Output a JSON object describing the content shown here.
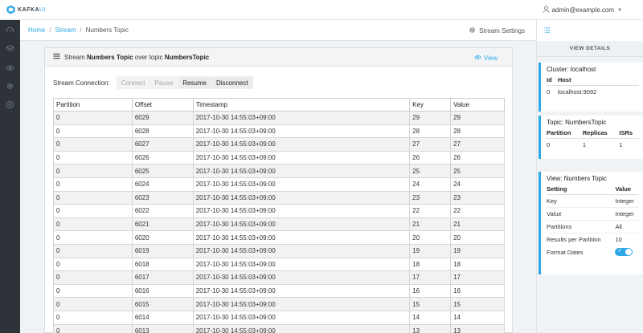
{
  "app": {
    "logo_main": "KAFKA",
    "logo_ui": "UI",
    "user_email": "admin@example.com"
  },
  "breadcrumb": {
    "home": "Home",
    "stream": "Stream",
    "current": "Numbers Topic"
  },
  "toolbar": {
    "stream_settings": "Stream Settings"
  },
  "card": {
    "prefix": "Stream",
    "stream_name": "Numbers Topic",
    "middle": "over topic",
    "topic_name": "NumbersTopic",
    "view_label": "View"
  },
  "connection": {
    "label": "Stream Connection:",
    "buttons": [
      {
        "label": "Connect",
        "enabled": false
      },
      {
        "label": "Pause",
        "enabled": false
      },
      {
        "label": "Resume",
        "enabled": true
      },
      {
        "label": "Disconnect",
        "enabled": true
      }
    ]
  },
  "messages": {
    "columns": [
      "Partition",
      "Offset",
      "Timestamp",
      "Key",
      "Value"
    ],
    "rows": [
      [
        "0",
        "6029",
        "2017-10-30 14:55:03+09:00",
        "29",
        "29"
      ],
      [
        "0",
        "6028",
        "2017-10-30 14:55:03+09:00",
        "28",
        "28"
      ],
      [
        "0",
        "6027",
        "2017-10-30 14:55:03+09:00",
        "27",
        "27"
      ],
      [
        "0",
        "6026",
        "2017-10-30 14:55:03+09:00",
        "26",
        "26"
      ],
      [
        "0",
        "6025",
        "2017-10-30 14:55:03+09:00",
        "25",
        "25"
      ],
      [
        "0",
        "6024",
        "2017-10-30 14:55:03+09:00",
        "24",
        "24"
      ],
      [
        "0",
        "6023",
        "2017-10-30 14:55:03+09:00",
        "23",
        "23"
      ],
      [
        "0",
        "6022",
        "2017-10-30 14:55:03+09:00",
        "22",
        "22"
      ],
      [
        "0",
        "6021",
        "2017-10-30 14:55:03+09:00",
        "21",
        "21"
      ],
      [
        "0",
        "6020",
        "2017-10-30 14:55:03+09:00",
        "20",
        "20"
      ],
      [
        "0",
        "6019",
        "2017-10-30 14:55:03+09:00",
        "19",
        "19"
      ],
      [
        "0",
        "6018",
        "2017-10-30 14:55:03+09:00",
        "18",
        "18"
      ],
      [
        "0",
        "6017",
        "2017-10-30 14:55:03+09:00",
        "17",
        "17"
      ],
      [
        "0",
        "6016",
        "2017-10-30 14:55:03+09:00",
        "16",
        "16"
      ],
      [
        "0",
        "6015",
        "2017-10-30 14:55:03+09:00",
        "15",
        "15"
      ],
      [
        "0",
        "6014",
        "2017-10-30 14:55:03+09:00",
        "14",
        "14"
      ],
      [
        "0",
        "6013",
        "2017-10-30 14:55:03+09:00",
        "13",
        "13"
      ]
    ]
  },
  "details": {
    "header": "VIEW DETAILS",
    "cluster": {
      "title": "Cluster: localhost",
      "columns": [
        "Id",
        "Host"
      ],
      "rows": [
        [
          "0",
          "localhost:9092"
        ]
      ]
    },
    "topic": {
      "title": "Topic: NumbersTopic",
      "columns": [
        "Partition",
        "Replicas",
        "ISRs"
      ],
      "rows": [
        [
          "0",
          "1",
          "1"
        ]
      ]
    },
    "view": {
      "title": "View: Numbers Topic",
      "columns": [
        "Setting",
        "Value"
      ],
      "rows": [
        [
          "Key",
          "Integer"
        ],
        [
          "Value",
          "Integer"
        ],
        [
          "Partitions",
          "All"
        ],
        [
          "Results per Partition",
          "10"
        ]
      ],
      "format_dates_label": "Format Dates",
      "format_dates_on": true
    }
  },
  "icons": {
    "logo": "kafka-hexagon-icon",
    "user": "user-icon",
    "nav": [
      "dashboard-icon",
      "layers-icon",
      "eye-icon",
      "gear-icon",
      "settings-circle-icon"
    ],
    "stream_settings": "gear-icon",
    "toggle_details": "list-icon",
    "card_header": "menu-icon",
    "view": "eye-icon"
  },
  "colors": {
    "accent": "#2ea8e5",
    "sidebar": "#2d3339"
  }
}
